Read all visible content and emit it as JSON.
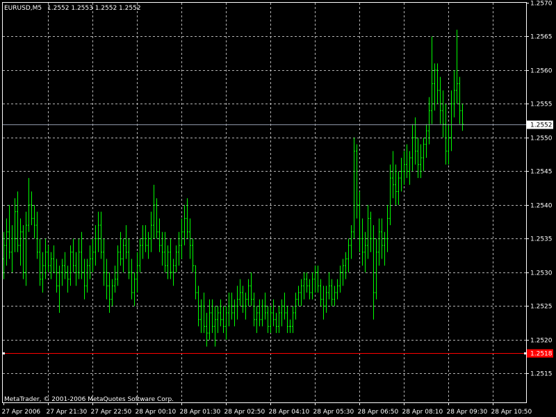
{
  "header": {
    "symbol_label": "EURUSD,M5",
    "ohlc_label": "1.2552 1.2553 1.2552 1.2552"
  },
  "footer": {
    "copyright": "MetaTrader, © 2001-2006 MetaQuotes Software Corp."
  },
  "colors": {
    "background": "#000000",
    "grid": "#b4b4b4",
    "frame": "#ffffff",
    "bar": "#00ff00",
    "bid_line": "#8f97a8",
    "level_line": "#ff0000",
    "text": "#ffffff"
  },
  "chart_data": {
    "type": "ohlc_bar",
    "symbol": "EURUSD",
    "timeframe": "M5",
    "ylim": [
      1.25105,
      1.257
    ],
    "y_ticks": [
      "1.2570",
      "1.2565",
      "1.2560",
      "1.2555",
      "1.2550",
      "1.2545",
      "1.2540",
      "1.2535",
      "1.2530",
      "1.2525",
      "1.2520",
      "1.2515"
    ],
    "y_tick_values": [
      1.257,
      1.2565,
      1.256,
      1.2555,
      1.255,
      1.2545,
      1.254,
      1.2535,
      1.253,
      1.2525,
      1.252,
      1.2515
    ],
    "x_ticks": [
      "27 Apr 2006",
      "27 Apr 21:30",
      "27 Apr 22:50",
      "28 Apr 00:10",
      "28 Apr 01:30",
      "28 Apr 02:50",
      "28 Apr 04:10",
      "28 Apr 05:30",
      "28 Apr 06:50",
      "28 Apr 08:10",
      "28 Apr 09:30",
      "28 Apr 10:50"
    ],
    "bars_per_tick": 16,
    "current_price": 1.2552,
    "current_price_label": "1.2552",
    "level_price": 1.2518,
    "level_label": "1.2518",
    "bars": [
      [
        1.2532,
        1.2536,
        1.2529,
        1.2534
      ],
      [
        1.2534,
        1.2538,
        1.2531,
        1.2536
      ],
      [
        1.2536,
        1.254,
        1.2532,
        1.2533
      ],
      [
        1.2533,
        1.2537,
        1.253,
        1.2535
      ],
      [
        1.2535,
        1.2541,
        1.2533,
        1.2539
      ],
      [
        1.2539,
        1.2542,
        1.2533,
        1.2534
      ],
      [
        1.2534,
        1.2538,
        1.2531,
        1.2536
      ],
      [
        1.2536,
        1.2537,
        1.2529,
        1.253
      ],
      [
        1.253,
        1.2539,
        1.2528,
        1.2537
      ],
      [
        1.2537,
        1.2544,
        1.2536,
        1.254
      ],
      [
        1.254,
        1.2542,
        1.2537,
        1.2538
      ],
      [
        1.2538,
        1.254,
        1.2535,
        1.2537
      ],
      [
        1.2537,
        1.2539,
        1.2532,
        1.2533
      ],
      [
        1.2533,
        1.2535,
        1.2528,
        1.2529
      ],
      [
        1.2529,
        1.2533,
        1.2527,
        1.2531
      ],
      [
        1.2531,
        1.2535,
        1.2529,
        1.2533
      ],
      [
        1.2533,
        1.2534,
        1.253,
        1.2531
      ],
      [
        1.2531,
        1.2533,
        1.2529,
        1.2532
      ],
      [
        1.2532,
        1.2534,
        1.253,
        1.253
      ],
      [
        1.253,
        1.2532,
        1.2527,
        1.2528
      ],
      [
        1.2528,
        1.2531,
        1.2524,
        1.253
      ],
      [
        1.253,
        1.2532,
        1.2528,
        1.2531
      ],
      [
        1.2531,
        1.2533,
        1.2529,
        1.253
      ],
      [
        1.253,
        1.2531,
        1.2527,
        1.2529
      ],
      [
        1.2529,
        1.2534,
        1.2528,
        1.2533
      ],
      [
        1.2533,
        1.2535,
        1.253,
        1.2531
      ],
      [
        1.2531,
        1.2533,
        1.2528,
        1.253
      ],
      [
        1.253,
        1.2535,
        1.2529,
        1.2533
      ],
      [
        1.2533,
        1.2536,
        1.2529,
        1.253
      ],
      [
        1.253,
        1.2532,
        1.2526,
        1.2528
      ],
      [
        1.2528,
        1.2532,
        1.2527,
        1.2531
      ],
      [
        1.2531,
        1.2534,
        1.2529,
        1.2532
      ],
      [
        1.2532,
        1.2535,
        1.253,
        1.2533
      ],
      [
        1.2533,
        1.2537,
        1.2531,
        1.2535
      ],
      [
        1.2535,
        1.2539,
        1.2533,
        1.2537
      ],
      [
        1.2537,
        1.2539,
        1.2532,
        1.2533
      ],
      [
        1.2533,
        1.2535,
        1.2528,
        1.253
      ],
      [
        1.253,
        1.2532,
        1.2526,
        1.2528
      ],
      [
        1.2528,
        1.253,
        1.2524,
        1.2526
      ],
      [
        1.2526,
        1.2529,
        1.2525,
        1.2528
      ],
      [
        1.2528,
        1.2531,
        1.2527,
        1.2529
      ],
      [
        1.2529,
        1.2534,
        1.2528,
        1.2533
      ],
      [
        1.2533,
        1.2536,
        1.2531,
        1.2532
      ],
      [
        1.2532,
        1.2535,
        1.253,
        1.2534
      ],
      [
        1.2534,
        1.2537,
        1.2532,
        1.2533
      ],
      [
        1.2533,
        1.2535,
        1.2529,
        1.253
      ],
      [
        1.253,
        1.2532,
        1.2526,
        1.2527
      ],
      [
        1.2527,
        1.253,
        1.2525,
        1.2529
      ],
      [
        1.2529,
        1.2533,
        1.2527,
        1.2531
      ],
      [
        1.2531,
        1.2535,
        1.253,
        1.2534
      ],
      [
        1.2534,
        1.2537,
        1.2532,
        1.2535
      ],
      [
        1.2535,
        1.2537,
        1.2533,
        1.2534
      ],
      [
        1.2534,
        1.2536,
        1.2532,
        1.2535
      ],
      [
        1.2535,
        1.2539,
        1.2533,
        1.2537
      ],
      [
        1.2537,
        1.2543,
        1.2535,
        1.254
      ],
      [
        1.254,
        1.2541,
        1.2535,
        1.2536
      ],
      [
        1.2536,
        1.2538,
        1.2533,
        1.2534
      ],
      [
        1.2534,
        1.2536,
        1.2531,
        1.2533
      ],
      [
        1.2533,
        1.2536,
        1.253,
        1.2531
      ],
      [
        1.2531,
        1.2534,
        1.2529,
        1.2533
      ],
      [
        1.2533,
        1.2535,
        1.2529,
        1.253
      ],
      [
        1.253,
        1.2532,
        1.2528,
        1.2531
      ],
      [
        1.2531,
        1.2534,
        1.253,
        1.2533
      ],
      [
        1.2533,
        1.2536,
        1.2531,
        1.2534
      ],
      [
        1.2534,
        1.2538,
        1.2532,
        1.2536
      ],
      [
        1.2536,
        1.254,
        1.2534,
        1.2538
      ],
      [
        1.2538,
        1.2541,
        1.2535,
        1.2536
      ],
      [
        1.2536,
        1.2538,
        1.2532,
        1.2534
      ],
      [
        1.2534,
        1.2535,
        1.253,
        1.2531
      ],
      [
        1.2531,
        1.2531,
        1.2526,
        1.2527
      ],
      [
        1.2527,
        1.2528,
        1.2522,
        1.2523
      ],
      [
        1.2523,
        1.2526,
        1.2521,
        1.2525
      ],
      [
        1.2525,
        1.2527,
        1.2521,
        1.2522
      ],
      [
        1.2522,
        1.2524,
        1.2519,
        1.2521
      ],
      [
        1.2521,
        1.2526,
        1.252,
        1.2524
      ],
      [
        1.2524,
        1.2526,
        1.2521,
        1.2522
      ],
      [
        1.2522,
        1.2525,
        1.2519,
        1.2523
      ],
      [
        1.2523,
        1.2525,
        1.2521,
        1.2524
      ],
      [
        1.2524,
        1.2526,
        1.2522,
        1.2523
      ],
      [
        1.2523,
        1.2525,
        1.2521,
        1.2522
      ],
      [
        1.2522,
        1.2525,
        1.252,
        1.2524
      ],
      [
        1.2524,
        1.2527,
        1.2522,
        1.2525
      ],
      [
        1.2525,
        1.2527,
        1.2523,
        1.2524
      ],
      [
        1.2524,
        1.2526,
        1.2522,
        1.2525
      ],
      [
        1.2525,
        1.2528,
        1.2523,
        1.2526
      ],
      [
        1.2526,
        1.2529,
        1.2525,
        1.2527
      ],
      [
        1.2527,
        1.2528,
        1.2524,
        1.2525
      ],
      [
        1.2525,
        1.2527,
        1.2523,
        1.2526
      ],
      [
        1.2526,
        1.2529,
        1.2525,
        1.2528
      ],
      [
        1.2528,
        1.253,
        1.2525,
        1.2526
      ],
      [
        1.2526,
        1.2527,
        1.2522,
        1.2523
      ],
      [
        1.2523,
        1.2525,
        1.2521,
        1.2524
      ],
      [
        1.2524,
        1.2526,
        1.2522,
        1.2523
      ],
      [
        1.2523,
        1.2526,
        1.2522,
        1.2525
      ],
      [
        1.2525,
        1.2527,
        1.2523,
        1.2524
      ],
      [
        1.2524,
        1.2525,
        1.2521,
        1.2522
      ],
      [
        1.2522,
        1.2525,
        1.2521,
        1.2524
      ],
      [
        1.2524,
        1.2526,
        1.2522,
        1.2523
      ],
      [
        1.2523,
        1.2524,
        1.2521,
        1.2522
      ],
      [
        1.2522,
        1.2525,
        1.2521,
        1.2524
      ],
      [
        1.2524,
        1.2526,
        1.2522,
        1.2525
      ],
      [
        1.2525,
        1.2527,
        1.2523,
        1.2524
      ],
      [
        1.2524,
        1.2525,
        1.2521,
        1.2522
      ],
      [
        1.2522,
        1.2523,
        1.2521,
        1.2522
      ],
      [
        1.2522,
        1.2525,
        1.2521,
        1.2524
      ],
      [
        1.2524,
        1.2527,
        1.2523,
        1.2526
      ],
      [
        1.2526,
        1.2528,
        1.2525,
        1.2527
      ],
      [
        1.2527,
        1.2529,
        1.2525,
        1.2528
      ],
      [
        1.2528,
        1.253,
        1.2526,
        1.2529
      ],
      [
        1.2529,
        1.253,
        1.2527,
        1.2528
      ],
      [
        1.2528,
        1.2529,
        1.2526,
        1.2527
      ],
      [
        1.2527,
        1.253,
        1.2526,
        1.2529
      ],
      [
        1.2529,
        1.2531,
        1.2527,
        1.253
      ],
      [
        1.253,
        1.2531,
        1.2527,
        1.2528
      ],
      [
        1.2528,
        1.2529,
        1.2525,
        1.2526
      ],
      [
        1.2526,
        1.2528,
        1.2523,
        1.2525
      ],
      [
        1.2525,
        1.2528,
        1.2524,
        1.2527
      ],
      [
        1.2527,
        1.253,
        1.2526,
        1.2528
      ],
      [
        1.2528,
        1.2529,
        1.2525,
        1.2526
      ],
      [
        1.2526,
        1.2528,
        1.2525,
        1.2527
      ],
      [
        1.2527,
        1.2529,
        1.2526,
        1.2528
      ],
      [
        1.2528,
        1.2531,
        1.2527,
        1.253
      ],
      [
        1.253,
        1.2532,
        1.2528,
        1.2531
      ],
      [
        1.2531,
        1.2533,
        1.2529,
        1.2532
      ],
      [
        1.2532,
        1.2535,
        1.253,
        1.2534
      ],
      [
        1.2534,
        1.2537,
        1.2532,
        1.2536
      ],
      [
        1.2536,
        1.255,
        1.2535,
        1.2548
      ],
      [
        1.2548,
        1.2549,
        1.2538,
        1.254
      ],
      [
        1.254,
        1.2542,
        1.2533,
        1.2535
      ],
      [
        1.2535,
        1.2538,
        1.2531,
        1.2533
      ],
      [
        1.2533,
        1.2536,
        1.253,
        1.2534
      ],
      [
        1.2534,
        1.254,
        1.2532,
        1.2538
      ],
      [
        1.2538,
        1.2539,
        1.2533,
        1.2535
      ],
      [
        1.2535,
        1.2537,
        1.2523,
        1.2527
      ],
      [
        1.2527,
        1.2535,
        1.2526,
        1.2533
      ],
      [
        1.2533,
        1.2538,
        1.2531,
        1.2536
      ],
      [
        1.2536,
        1.2538,
        1.2532,
        1.2534
      ],
      [
        1.2534,
        1.2536,
        1.2531,
        1.2535
      ],
      [
        1.2535,
        1.254,
        1.2533,
        1.2538
      ],
      [
        1.2538,
        1.2546,
        1.2537,
        1.2544
      ],
      [
        1.2544,
        1.2548,
        1.2541,
        1.2543
      ],
      [
        1.2543,
        1.2546,
        1.254,
        1.2542
      ],
      [
        1.2542,
        1.2545,
        1.254,
        1.2544
      ],
      [
        1.2544,
        1.2547,
        1.2542,
        1.2545
      ],
      [
        1.2545,
        1.2548,
        1.2543,
        1.2546
      ],
      [
        1.2546,
        1.2549,
        1.2544,
        1.2545
      ],
      [
        1.2545,
        1.2548,
        1.2543,
        1.2547
      ],
      [
        1.2547,
        1.2552,
        1.2545,
        1.255
      ],
      [
        1.255,
        1.2553,
        1.2546,
        1.2548
      ],
      [
        1.2548,
        1.255,
        1.2544,
        1.2546
      ],
      [
        1.2546,
        1.2549,
        1.2544,
        1.2547
      ],
      [
        1.2547,
        1.255,
        1.2545,
        1.2549
      ],
      [
        1.2549,
        1.2552,
        1.2547,
        1.2551
      ],
      [
        1.2551,
        1.2556,
        1.2549,
        1.2554
      ],
      [
        1.2554,
        1.2565,
        1.2552,
        1.2558
      ],
      [
        1.2558,
        1.2561,
        1.2554,
        1.256
      ],
      [
        1.256,
        1.2561,
        1.2555,
        1.2557
      ],
      [
        1.2557,
        1.2559,
        1.2552,
        1.2554
      ],
      [
        1.2554,
        1.2557,
        1.255,
        1.2552
      ],
      [
        1.2552,
        1.2555,
        1.2546,
        1.2548
      ],
      [
        1.2548,
        1.2552,
        1.2546,
        1.255
      ],
      [
        1.255,
        1.2557,
        1.2548,
        1.2555
      ],
      [
        1.2555,
        1.256,
        1.2553,
        1.2557
      ],
      [
        1.2557,
        1.2566,
        1.2555,
        1.2558
      ],
      [
        1.2558,
        1.2559,
        1.2552,
        1.2554
      ],
      [
        1.2554,
        1.2555,
        1.2551,
        1.2552
      ]
    ]
  }
}
